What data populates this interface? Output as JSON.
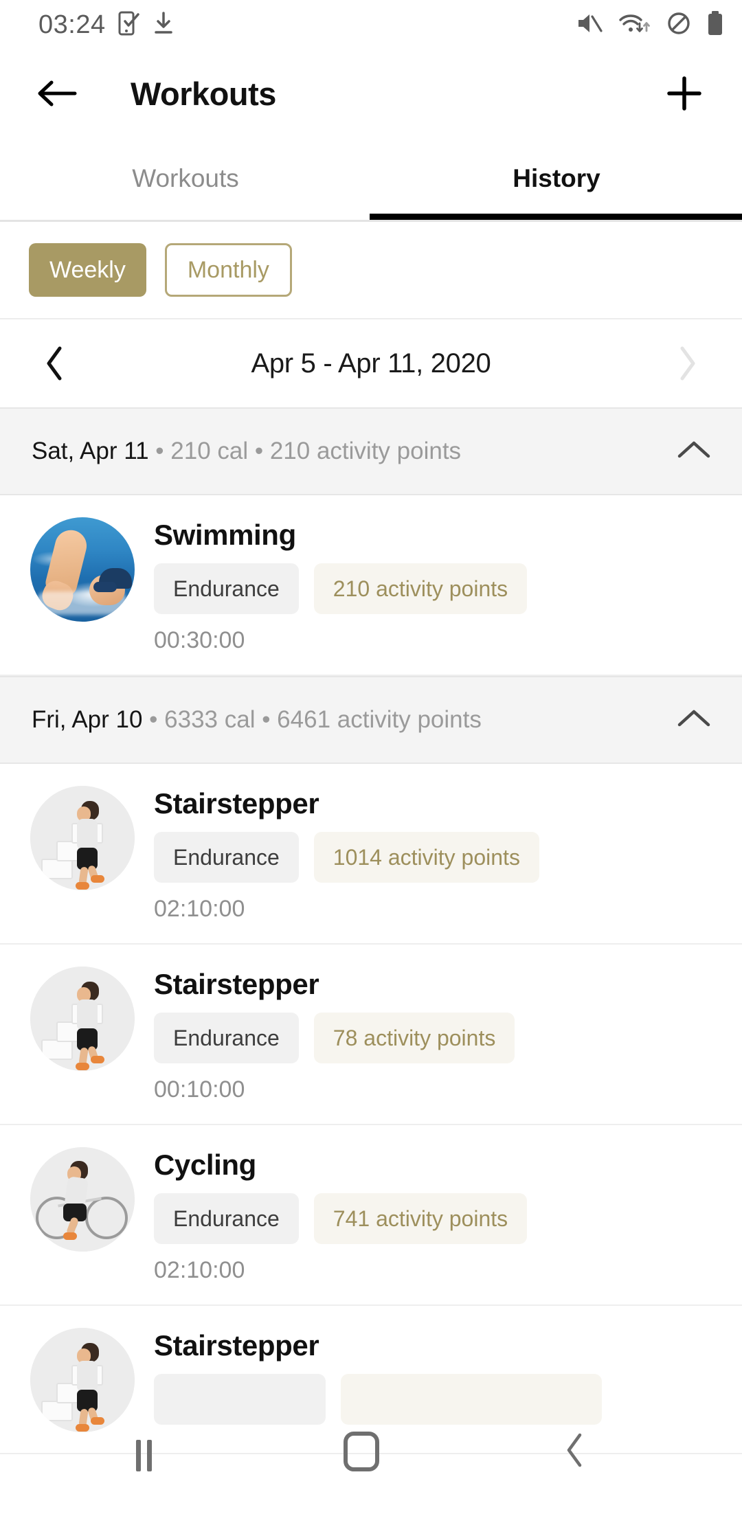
{
  "status_bar": {
    "time": "03:24",
    "left_icons": [
      "phone-check-icon",
      "download-icon"
    ],
    "right_icons": [
      "mute-icon",
      "wifi-icon",
      "do-not-disturb-icon",
      "battery-icon"
    ]
  },
  "app_bar": {
    "back_icon": "arrow-left-icon",
    "title": "Workouts",
    "add_icon": "plus-icon"
  },
  "tabs": [
    {
      "label": "Workouts",
      "active": false
    },
    {
      "label": "History",
      "active": true
    }
  ],
  "period_toggle": {
    "options": [
      {
        "label": "Weekly",
        "selected": true
      },
      {
        "label": "Monthly",
        "selected": false
      }
    ]
  },
  "date_nav": {
    "prev_icon": "chevron-left-icon",
    "range_label": "Apr 5 - Apr 11, 2020",
    "next_icon": "chevron-right-icon",
    "next_disabled": true
  },
  "days": [
    {
      "date": "Sat, Apr 11",
      "meta": " • 210 cal • 210 activity points",
      "collapse_icon": "chevron-up-icon",
      "workouts": [
        {
          "title": "Swimming",
          "type_chip": "Endurance",
          "points_chip": "210 activity points",
          "duration": "00:30:00",
          "thumb": "swimming-photo"
        }
      ]
    },
    {
      "date": "Fri, Apr 10",
      "meta": " • 6333 cal • 6461 activity points",
      "collapse_icon": "chevron-up-icon",
      "workouts": [
        {
          "title": "Stairstepper",
          "type_chip": "Endurance",
          "points_chip": "1014 activity points",
          "duration": "02:10:00",
          "thumb": "stairstepper-icon"
        },
        {
          "title": "Stairstepper",
          "type_chip": "Endurance",
          "points_chip": "78 activity points",
          "duration": "00:10:00",
          "thumb": "stairstepper-icon"
        },
        {
          "title": "Cycling",
          "type_chip": "Endurance",
          "points_chip": "741 activity points",
          "duration": "02:10:00",
          "thumb": "cycling-icon"
        },
        {
          "title": "Stairstepper",
          "type_chip": "",
          "points_chip": "",
          "duration": "",
          "thumb": "stairstepper-icon"
        }
      ]
    }
  ],
  "nav_bar": {
    "recents_icon": "recents-icon",
    "home_icon": "home-icon",
    "back_icon": "back-chevron-icon"
  },
  "colors": {
    "accent": "#a89a64",
    "accent_text": "#9d8f5c",
    "chip_points_bg": "#f7f5ef",
    "chip_type_bg": "#f1f1f1",
    "day_header_bg": "#f4f4f4",
    "muted_text": "#9a9a9a"
  }
}
